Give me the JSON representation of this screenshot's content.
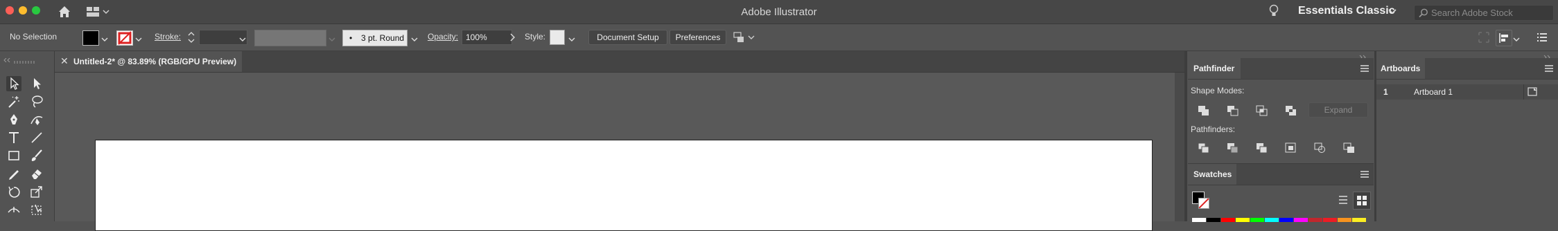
{
  "window": {
    "title": "Adobe Illustrator"
  },
  "workspace": {
    "label": "Essentials Classic"
  },
  "search": {
    "placeholder": "Search Adobe Stock"
  },
  "control_bar": {
    "selection": "No Selection",
    "stroke_label": "Stroke:",
    "brush": "3 pt. Round",
    "opacity_label": "Opacity:",
    "opacity_value": "100%",
    "style_label": "Style:",
    "document_setup": "Document Setup",
    "preferences": "Preferences"
  },
  "document": {
    "tab_title": "Untitled-2* @ 83.89% (RGB/GPU Preview)"
  },
  "pathfinder": {
    "title": "Pathfinder",
    "shape_modes_label": "Shape Modes:",
    "expand_label": "Expand",
    "pathfinders_label": "Pathfinders:"
  },
  "swatches": {
    "title": "Swatches",
    "colors": [
      "#ffffff",
      "#000000",
      "#ff0000",
      "#ffff00",
      "#00ff00",
      "#00ffff",
      "#0000ff",
      "#ff00ff",
      "#c1272d",
      "#ed1c24",
      "#f7931e",
      "#fcee21"
    ]
  },
  "artboards": {
    "title": "Artboards",
    "rows": [
      {
        "number": "1",
        "name": "Artboard 1"
      }
    ]
  },
  "colors": {
    "titlebar": "#474747",
    "panel": "#535353",
    "canvas": "#595959",
    "accent_red": "#e02020"
  }
}
